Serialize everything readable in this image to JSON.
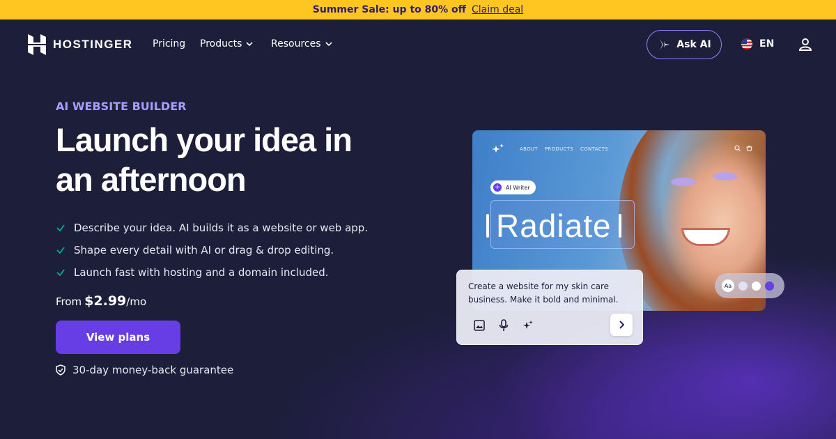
{
  "promo": {
    "text": "Summer Sale: up to 80% off",
    "link": "Claim deal"
  },
  "nav": {
    "brand": "HOSTINGER",
    "links": [
      {
        "label": "Pricing"
      },
      {
        "label": "Products",
        "has_dropdown": true
      },
      {
        "label": "Resources",
        "has_dropdown": true
      }
    ],
    "ask_ai_label": "Ask AI",
    "language": "EN"
  },
  "hero": {
    "eyebrow": "AI WEBSITE BUILDER",
    "headline": "Launch your idea in an afternoon",
    "features": [
      "Describe your idea. AI builds it as a website or web app.",
      "Shape every detail with AI or drag & drop editing.",
      "Launch fast with hosting and a domain included."
    ],
    "price_prefix": "From",
    "price_amount": "$2.99",
    "price_suffix": "/mo",
    "cta_label": "View plans",
    "guarantee": "30-day money-back guarantee"
  },
  "preview": {
    "nav_items": [
      "ABOUT",
      "PRODUCTS",
      "CONTACTS"
    ],
    "ai_writer_label": "AI Writer",
    "headline": "Radiate",
    "prompt": "Create a website for my skin care business. Make it bold and minimal.",
    "swatches": [
      "#e4e0f5",
      "#ffffff",
      "#673de6"
    ]
  },
  "colors": {
    "promo_bg": "#ffc621",
    "page_bg": "#1d1e3a",
    "accent": "#673de6",
    "eyebrow": "#a99bff"
  }
}
